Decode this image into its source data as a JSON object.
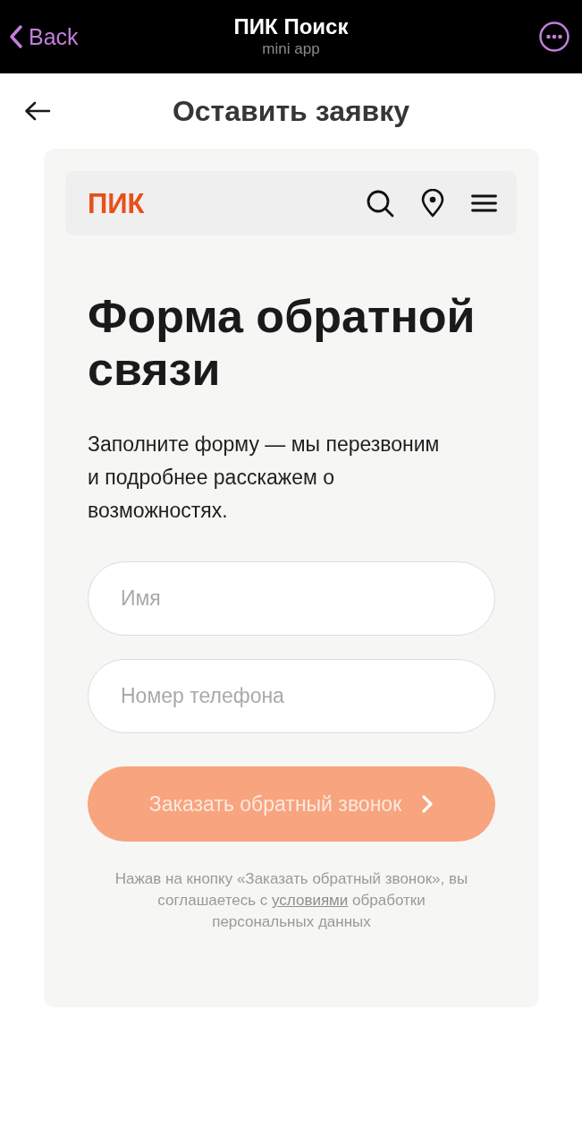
{
  "top_bar": {
    "back": "Back",
    "title": "ПИК Поиск",
    "subtitle": "mini app"
  },
  "header": {
    "title": "Оставить заявку"
  },
  "site_nav": {
    "logo": "ПИК"
  },
  "form": {
    "heading": "Форма обратной связи",
    "description": "Заполните форму — мы перезвоним и подробнее расскажем о возможностях.",
    "fields": [
      {
        "placeholder": "Имя"
      },
      {
        "placeholder": "Номер телефона"
      }
    ],
    "submit": {
      "label": "Заказать обратный звонок",
      "disabled": true
    },
    "consent": {
      "before": "Нажав на кнопку «Заказать обратный звонок», вы соглашаетесь с",
      "link": "условиями",
      "after": "обработки персональных данных"
    }
  }
}
